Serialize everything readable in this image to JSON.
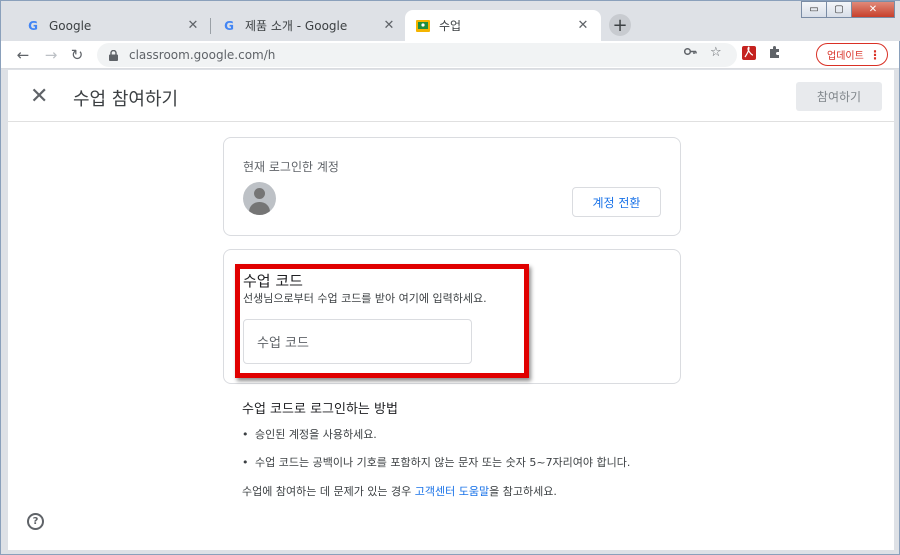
{
  "browser": {
    "tabs": [
      {
        "title": "Google",
        "favicon": "google-g-icon",
        "close": "✕"
      },
      {
        "title": "제품 소개 - Google",
        "favicon": "google-g-icon",
        "close": "✕"
      },
      {
        "title": "수업",
        "favicon": "classroom-icon",
        "close": "✕"
      }
    ],
    "new_tab": "+",
    "url": "classroom.google.com/h",
    "update_label": "업데이트",
    "update_menu": "⋮",
    "window_controls": {
      "minimize": "▭",
      "maximize": "▢",
      "close": "✕"
    }
  },
  "appbar": {
    "close": "✕",
    "title": "수업 참여하기",
    "join_label": "참여하기"
  },
  "account_card": {
    "label": "현재 로그인한 계정",
    "switch_label": "계정 전환"
  },
  "code_card": {
    "heading": "수업 코드",
    "subtitle": "선생님으로부터 수업 코드를 받아 여기에 입력하세요.",
    "input_placeholder": "수업 코드"
  },
  "howto": {
    "heading": "수업 코드로 로그인하는 방법",
    "items": [
      "승인된 계정을 사용하세요.",
      "수업 코드는 공백이나 기호를 포함하지 않는 문자 또는 숫자 5~7자리여야 합니다."
    ],
    "footer_prefix": "수업에 참여하는 데 문제가 있는 경우 ",
    "footer_link": "고객센터 도움말",
    "footer_suffix": "을 참고하세요."
  },
  "help": "?",
  "colors": {
    "accent": "#1a73e8",
    "highlight": "#e00000",
    "update": "#d93025"
  }
}
